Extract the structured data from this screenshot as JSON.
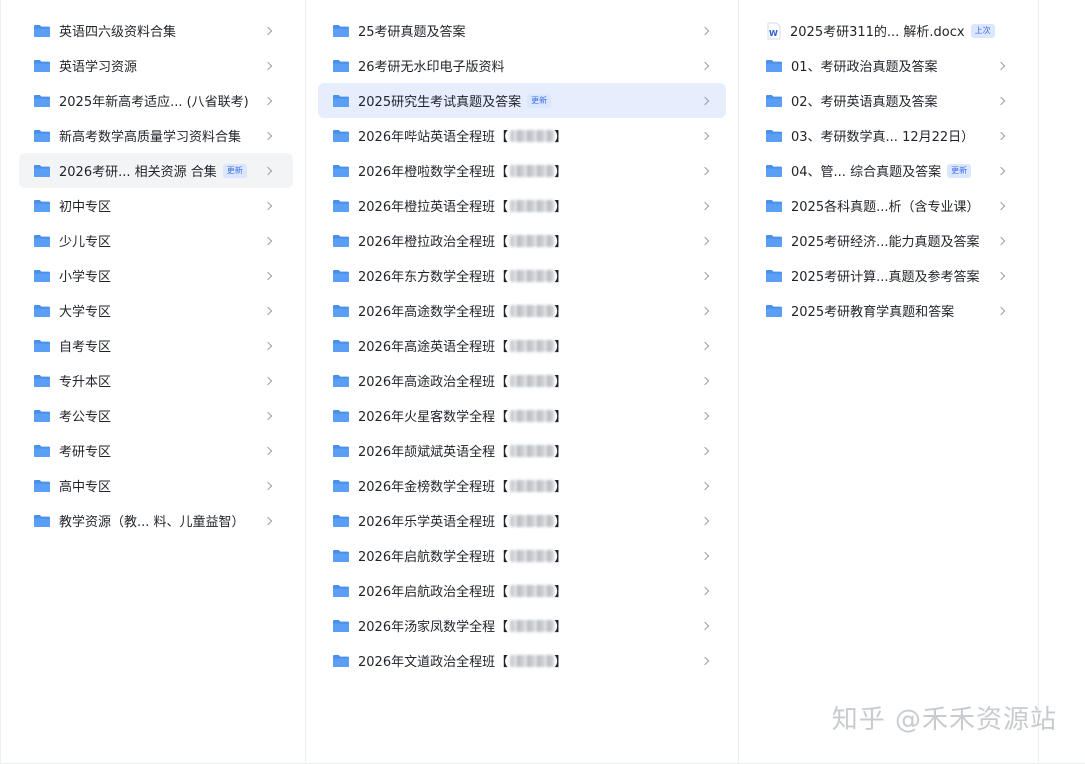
{
  "columns": [
    {
      "items": [
        {
          "label": "英语四六级资料合集"
        },
        {
          "label": "英语学习资源"
        },
        {
          "label": "2025年新高考适应... (八省联考)"
        },
        {
          "label": "新高考数学高质量学习资料合集"
        },
        {
          "label": "2026考研... 相关资源 合集",
          "badge": "更新",
          "state": "hover"
        },
        {
          "label": "初中专区"
        },
        {
          "label": "少儿专区"
        },
        {
          "label": "小学专区"
        },
        {
          "label": "大学专区"
        },
        {
          "label": "自考专区"
        },
        {
          "label": "专升本区"
        },
        {
          "label": "考公专区"
        },
        {
          "label": "考研专区"
        },
        {
          "label": "高中专区"
        },
        {
          "label": "教学资源（教... 料、儿童益智）"
        }
      ]
    },
    {
      "items": [
        {
          "label": "25考研真题及答案"
        },
        {
          "label": "26考研无水印电子版资料"
        },
        {
          "label": "2025研究生考试真题及答案",
          "badge": "更新",
          "state": "selected"
        },
        {
          "label": "2026年哔站英语全程班",
          "blurred": true,
          "bracket": "【",
          "closing": "】"
        },
        {
          "label": "2026年橙啦数学全程班",
          "blurred": true,
          "bracket": "【",
          "closing": "】"
        },
        {
          "label": "2026年橙拉英语全程班",
          "blurred": true,
          "bracket": "【",
          "closing": "】"
        },
        {
          "label": "2026年橙拉政治全程班",
          "blurred": true,
          "bracket": "【",
          "closing": "】"
        },
        {
          "label": "2026年东方数学全程班",
          "blurred": true,
          "bracket": "【",
          "closing": "】"
        },
        {
          "label": "2026年高途数学全程班",
          "blurred": true,
          "bracket": "【",
          "closing": "】"
        },
        {
          "label": "2026年高途英语全程班",
          "blurred": true,
          "bracket": "【",
          "closing": "】"
        },
        {
          "label": "2026年高途政治全程班",
          "blurred": true,
          "bracket": "【",
          "closing": "】"
        },
        {
          "label": "2026年火星客数学全程",
          "blurred": true,
          "bracket": "【",
          "closing": "】"
        },
        {
          "label": "2026年颉斌斌英语全程",
          "blurred": true,
          "bracket": "【",
          "closing": "】"
        },
        {
          "label": "2026年金榜数学全程班",
          "blurred": true,
          "bracket": "【",
          "closing": "】"
        },
        {
          "label": "2026年乐学英语全程班",
          "blurred": true,
          "bracket": "【",
          "closing": "】"
        },
        {
          "label": "2026年启航数学全程班",
          "blurred": true,
          "bracket": "【",
          "closing": "】"
        },
        {
          "label": "2026年启航政治全程班",
          "blurred": true,
          "bracket": "【",
          "closing": "】"
        },
        {
          "label": "2026年汤家凤数学全程",
          "blurred": true,
          "bracket": "【",
          "closing": "】"
        },
        {
          "label": "2026年文道政治全程班",
          "blurred": true,
          "bracket": "【",
          "closing": "】"
        }
      ]
    },
    {
      "items": [
        {
          "label": "2025考研311的...  解析.docx",
          "badge": "上次",
          "type": "doc",
          "icon_letter": "W"
        },
        {
          "label": "01、考研政治真题及答案"
        },
        {
          "label": "02、考研英语真题及答案"
        },
        {
          "label": "03、考研数学真...  12月22日）"
        },
        {
          "label": "04、管...  综合真题及答案",
          "badge": "更新"
        },
        {
          "label": "2025各科真题...析（含专业课）"
        },
        {
          "label": "2025考研经济...能力真题及答案"
        },
        {
          "label": "2025考研计算...真题及参考答案"
        },
        {
          "label": "2025考研教育学真题和答案"
        }
      ]
    }
  ],
  "watermark": "知乎 @禾禾资源站",
  "colors": {
    "folder": "#5a9ff5",
    "folder_tab": "#4a8fe8",
    "selected_bg": "#e6edfd",
    "hover_bg": "#f3f4f6",
    "badge_text": "#3a6fe8",
    "badge_bg": "#dbe6ff",
    "doc_blue": "#2a62d6"
  }
}
